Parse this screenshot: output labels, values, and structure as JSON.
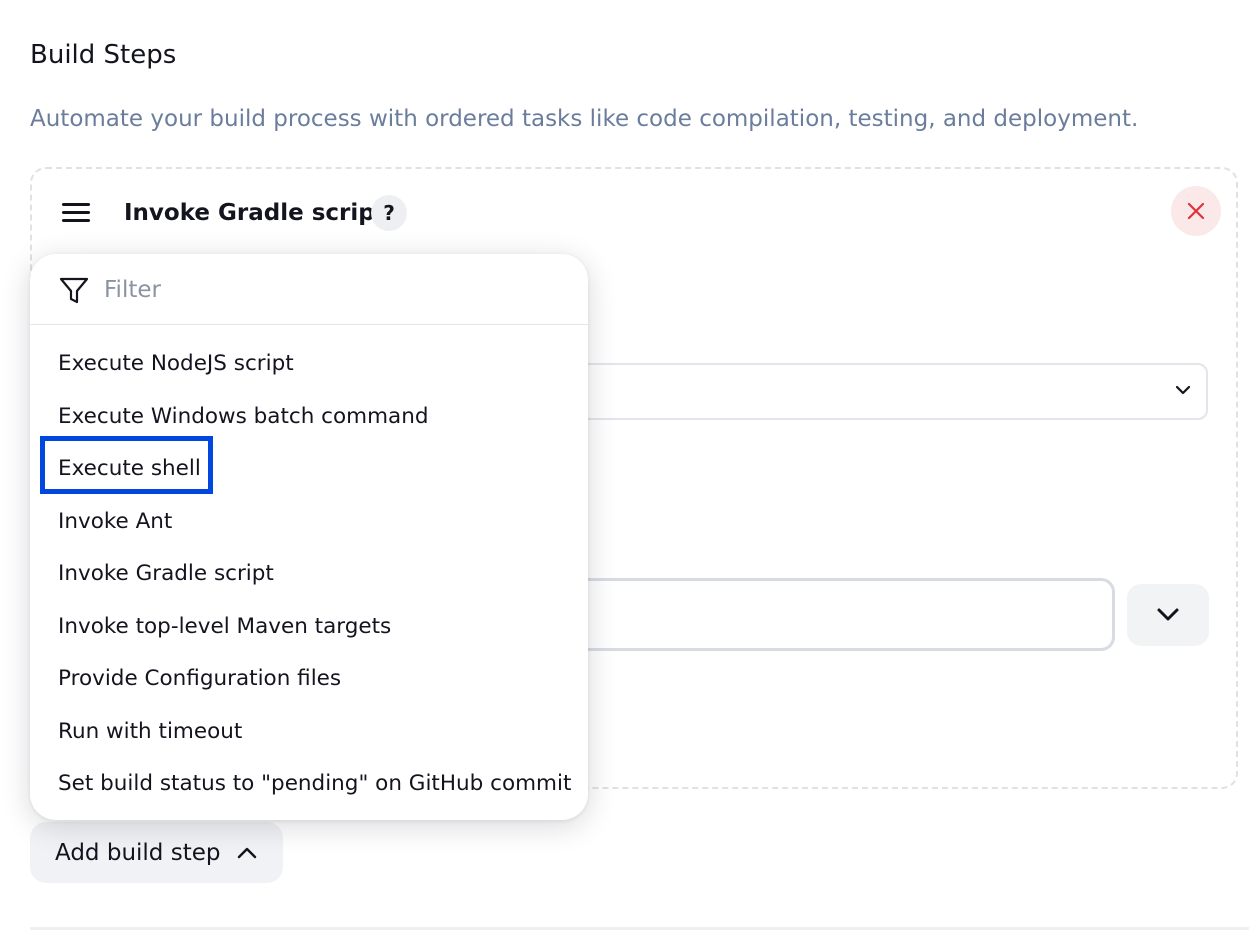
{
  "section": {
    "title": "Build Steps",
    "description": "Automate your build process with ordered tasks like code compilation, testing, and deployment."
  },
  "step": {
    "title": "Invoke Gradle script",
    "help_label": "?",
    "icons": {
      "drag": "drag-handle-icon",
      "close": "close-icon",
      "help": "help-icon"
    }
  },
  "dropdown": {
    "filter_placeholder": "Filter",
    "items": [
      {
        "label": "Execute NodeJS script"
      },
      {
        "label": "Execute Windows batch command"
      },
      {
        "label": "Execute shell",
        "highlighted": true
      },
      {
        "label": "Invoke Ant"
      },
      {
        "label": "Invoke Gradle script"
      },
      {
        "label": "Invoke top-level Maven targets"
      },
      {
        "label": "Provide Configuration files"
      },
      {
        "label": "Run with timeout"
      },
      {
        "label": "Set build status to \"pending\" on GitHub commit"
      }
    ]
  },
  "add_button": {
    "label": "Add build step",
    "state": "expanded"
  },
  "colors": {
    "accent_highlight": "#0047e0",
    "description_text": "#6b7d9c",
    "close_icon": "#e0323a",
    "close_bg": "#fbe9ea"
  }
}
